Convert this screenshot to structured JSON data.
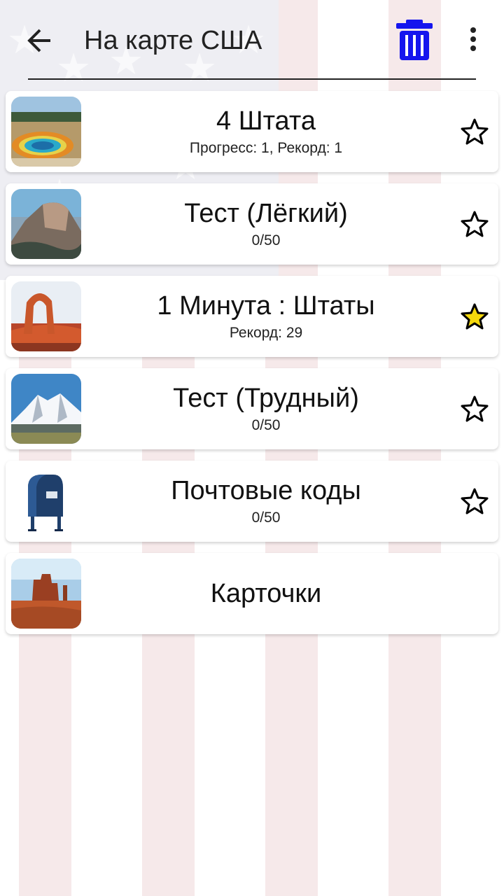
{
  "app_bar": {
    "title": "На карте США",
    "back_icon": "arrow-left-icon",
    "delete_icon": "trash-icon",
    "more_icon": "more-vert-icon"
  },
  "colors": {
    "trash": "#1515ee",
    "star_filled": "#f4d80c",
    "stripe": "#f6e9ea"
  },
  "items": [
    {
      "name": "4 Штата",
      "sub": "Прогресс: 1, Рекорд: 1",
      "image": "yellowstone-spring",
      "favorite": false
    },
    {
      "name": "Тест (Лёгкий)",
      "sub": "0/50",
      "image": "half-dome",
      "favorite": false
    },
    {
      "name": "1 Минута : Штаты",
      "sub": "Рекорд: 29",
      "image": "delicate-arch",
      "favorite": true
    },
    {
      "name": "Тест (Трудный)",
      "sub": "0/50",
      "image": "denali",
      "favorite": false
    },
    {
      "name": "Почтовые коды",
      "sub": "0/50",
      "image": "mailbox",
      "favorite": false
    },
    {
      "name": "Карточки",
      "sub": "",
      "image": "monument-valley",
      "favorite": null
    }
  ]
}
